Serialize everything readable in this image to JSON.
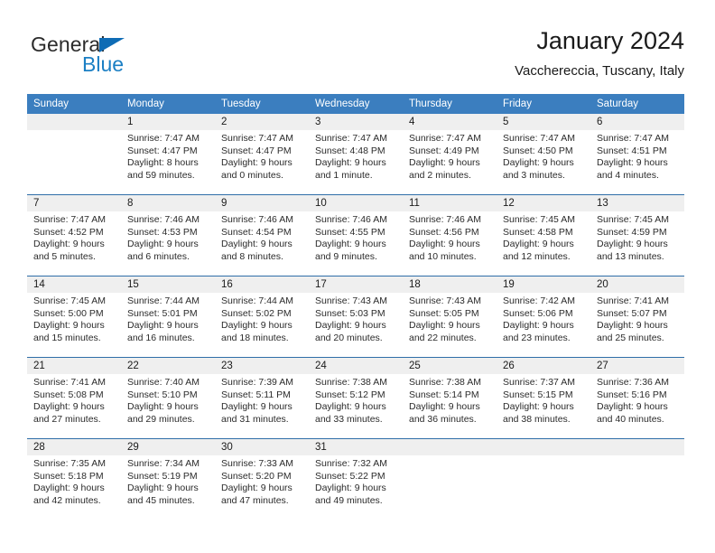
{
  "brand": {
    "name_part1": "General",
    "name_part2": "Blue",
    "logo_icon": "triangle-flag-icon"
  },
  "header": {
    "title": "January 2024",
    "subtitle": "Vacchereccia, Tuscany, Italy"
  },
  "colors": {
    "header_blue": "#3b7ebf",
    "row_rule_blue": "#2f6ea8",
    "daynum_band": "#efefef",
    "brand_blue": "#1b7fc4"
  },
  "weekdays": [
    "Sunday",
    "Monday",
    "Tuesday",
    "Wednesday",
    "Thursday",
    "Friday",
    "Saturday"
  ],
  "chart_data": {
    "type": "table",
    "title": "January 2024 — Sunrise, Sunset and Daylight",
    "subtitle": "Vacchereccia, Tuscany, Italy",
    "columns": [
      "Sunday",
      "Monday",
      "Tuesday",
      "Wednesday",
      "Thursday",
      "Friday",
      "Saturday"
    ],
    "rows": [
      [
        {
          "day": "",
          "empty": true
        },
        {
          "day": "1",
          "sunrise": "Sunrise: 7:47 AM",
          "sunset": "Sunset: 4:47 PM",
          "daylight1": "Daylight: 8 hours",
          "daylight2": "and 59 minutes."
        },
        {
          "day": "2",
          "sunrise": "Sunrise: 7:47 AM",
          "sunset": "Sunset: 4:47 PM",
          "daylight1": "Daylight: 9 hours",
          "daylight2": "and 0 minutes."
        },
        {
          "day": "3",
          "sunrise": "Sunrise: 7:47 AM",
          "sunset": "Sunset: 4:48 PM",
          "daylight1": "Daylight: 9 hours",
          "daylight2": "and 1 minute."
        },
        {
          "day": "4",
          "sunrise": "Sunrise: 7:47 AM",
          "sunset": "Sunset: 4:49 PM",
          "daylight1": "Daylight: 9 hours",
          "daylight2": "and 2 minutes."
        },
        {
          "day": "5",
          "sunrise": "Sunrise: 7:47 AM",
          "sunset": "Sunset: 4:50 PM",
          "daylight1": "Daylight: 9 hours",
          "daylight2": "and 3 minutes."
        },
        {
          "day": "6",
          "sunrise": "Sunrise: 7:47 AM",
          "sunset": "Sunset: 4:51 PM",
          "daylight1": "Daylight: 9 hours",
          "daylight2": "and 4 minutes."
        }
      ],
      [
        {
          "day": "7",
          "sunrise": "Sunrise: 7:47 AM",
          "sunset": "Sunset: 4:52 PM",
          "daylight1": "Daylight: 9 hours",
          "daylight2": "and 5 minutes."
        },
        {
          "day": "8",
          "sunrise": "Sunrise: 7:46 AM",
          "sunset": "Sunset: 4:53 PM",
          "daylight1": "Daylight: 9 hours",
          "daylight2": "and 6 minutes."
        },
        {
          "day": "9",
          "sunrise": "Sunrise: 7:46 AM",
          "sunset": "Sunset: 4:54 PM",
          "daylight1": "Daylight: 9 hours",
          "daylight2": "and 8 minutes."
        },
        {
          "day": "10",
          "sunrise": "Sunrise: 7:46 AM",
          "sunset": "Sunset: 4:55 PM",
          "daylight1": "Daylight: 9 hours",
          "daylight2": "and 9 minutes."
        },
        {
          "day": "11",
          "sunrise": "Sunrise: 7:46 AM",
          "sunset": "Sunset: 4:56 PM",
          "daylight1": "Daylight: 9 hours",
          "daylight2": "and 10 minutes."
        },
        {
          "day": "12",
          "sunrise": "Sunrise: 7:45 AM",
          "sunset": "Sunset: 4:58 PM",
          "daylight1": "Daylight: 9 hours",
          "daylight2": "and 12 minutes."
        },
        {
          "day": "13",
          "sunrise": "Sunrise: 7:45 AM",
          "sunset": "Sunset: 4:59 PM",
          "daylight1": "Daylight: 9 hours",
          "daylight2": "and 13 minutes."
        }
      ],
      [
        {
          "day": "14",
          "sunrise": "Sunrise: 7:45 AM",
          "sunset": "Sunset: 5:00 PM",
          "daylight1": "Daylight: 9 hours",
          "daylight2": "and 15 minutes."
        },
        {
          "day": "15",
          "sunrise": "Sunrise: 7:44 AM",
          "sunset": "Sunset: 5:01 PM",
          "daylight1": "Daylight: 9 hours",
          "daylight2": "and 16 minutes."
        },
        {
          "day": "16",
          "sunrise": "Sunrise: 7:44 AM",
          "sunset": "Sunset: 5:02 PM",
          "daylight1": "Daylight: 9 hours",
          "daylight2": "and 18 minutes."
        },
        {
          "day": "17",
          "sunrise": "Sunrise: 7:43 AM",
          "sunset": "Sunset: 5:03 PM",
          "daylight1": "Daylight: 9 hours",
          "daylight2": "and 20 minutes."
        },
        {
          "day": "18",
          "sunrise": "Sunrise: 7:43 AM",
          "sunset": "Sunset: 5:05 PM",
          "daylight1": "Daylight: 9 hours",
          "daylight2": "and 22 minutes."
        },
        {
          "day": "19",
          "sunrise": "Sunrise: 7:42 AM",
          "sunset": "Sunset: 5:06 PM",
          "daylight1": "Daylight: 9 hours",
          "daylight2": "and 23 minutes."
        },
        {
          "day": "20",
          "sunrise": "Sunrise: 7:41 AM",
          "sunset": "Sunset: 5:07 PM",
          "daylight1": "Daylight: 9 hours",
          "daylight2": "and 25 minutes."
        }
      ],
      [
        {
          "day": "21",
          "sunrise": "Sunrise: 7:41 AM",
          "sunset": "Sunset: 5:08 PM",
          "daylight1": "Daylight: 9 hours",
          "daylight2": "and 27 minutes."
        },
        {
          "day": "22",
          "sunrise": "Sunrise: 7:40 AM",
          "sunset": "Sunset: 5:10 PM",
          "daylight1": "Daylight: 9 hours",
          "daylight2": "and 29 minutes."
        },
        {
          "day": "23",
          "sunrise": "Sunrise: 7:39 AM",
          "sunset": "Sunset: 5:11 PM",
          "daylight1": "Daylight: 9 hours",
          "daylight2": "and 31 minutes."
        },
        {
          "day": "24",
          "sunrise": "Sunrise: 7:38 AM",
          "sunset": "Sunset: 5:12 PM",
          "daylight1": "Daylight: 9 hours",
          "daylight2": "and 33 minutes."
        },
        {
          "day": "25",
          "sunrise": "Sunrise: 7:38 AM",
          "sunset": "Sunset: 5:14 PM",
          "daylight1": "Daylight: 9 hours",
          "daylight2": "and 36 minutes."
        },
        {
          "day": "26",
          "sunrise": "Sunrise: 7:37 AM",
          "sunset": "Sunset: 5:15 PM",
          "daylight1": "Daylight: 9 hours",
          "daylight2": "and 38 minutes."
        },
        {
          "day": "27",
          "sunrise": "Sunrise: 7:36 AM",
          "sunset": "Sunset: 5:16 PM",
          "daylight1": "Daylight: 9 hours",
          "daylight2": "and 40 minutes."
        }
      ],
      [
        {
          "day": "28",
          "sunrise": "Sunrise: 7:35 AM",
          "sunset": "Sunset: 5:18 PM",
          "daylight1": "Daylight: 9 hours",
          "daylight2": "and 42 minutes."
        },
        {
          "day": "29",
          "sunrise": "Sunrise: 7:34 AM",
          "sunset": "Sunset: 5:19 PM",
          "daylight1": "Daylight: 9 hours",
          "daylight2": "and 45 minutes."
        },
        {
          "day": "30",
          "sunrise": "Sunrise: 7:33 AM",
          "sunset": "Sunset: 5:20 PM",
          "daylight1": "Daylight: 9 hours",
          "daylight2": "and 47 minutes."
        },
        {
          "day": "31",
          "sunrise": "Sunrise: 7:32 AM",
          "sunset": "Sunset: 5:22 PM",
          "daylight1": "Daylight: 9 hours",
          "daylight2": "and 49 minutes."
        },
        {
          "day": "",
          "empty": true
        },
        {
          "day": "",
          "empty": true
        },
        {
          "day": "",
          "empty": true
        }
      ]
    ]
  }
}
